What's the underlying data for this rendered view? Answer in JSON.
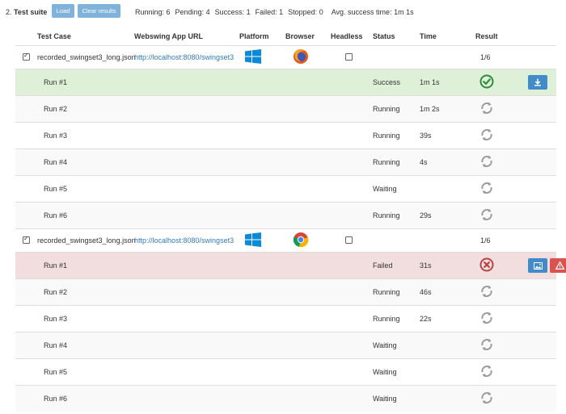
{
  "suite": {
    "index": "2.",
    "title": "Test suite"
  },
  "buttons": {
    "load": "Load",
    "clear": "Clear results"
  },
  "stats": {
    "running": "Running: 6",
    "pending": "Pending: 4",
    "success": "Success: 1",
    "failed": "Failed: 1",
    "stopped": "Stopped: 0",
    "avg": "Avg. success time: 1m 1s"
  },
  "columns": [
    "Test Case",
    "Webswing App URL",
    "Platform",
    "Browser",
    "Headless",
    "Status",
    "Time",
    "Result"
  ],
  "colors": {
    "success_bg": "#dff0d8",
    "failed_bg": "#f2dede",
    "blue_button": "#428bca",
    "red_button": "#d9534f",
    "link": "#337ab7"
  },
  "cases": [
    {
      "name": "recorded_swingset3_long.json",
      "url": "http://localhost:8080/swingset3",
      "platform_icon": "windows-icon",
      "browser_icon": "firefox-icon",
      "result": "1/6",
      "runs": [
        {
          "label": "Run #1",
          "status": "Success",
          "time": "1m 1s"
        },
        {
          "label": "Run #2",
          "status": "Running",
          "time": "1m 2s"
        },
        {
          "label": "Run #3",
          "status": "Running",
          "time": "39s"
        },
        {
          "label": "Run #4",
          "status": "Running",
          "time": "4s"
        },
        {
          "label": "Run #5",
          "status": "Waiting",
          "time": ""
        },
        {
          "label": "Run #6",
          "status": "Running",
          "time": "29s"
        }
      ]
    },
    {
      "name": "recorded_swingset3_long.json",
      "url": "http://localhost:8080/swingset3",
      "platform_icon": "windows-icon",
      "browser_icon": "chrome-icon",
      "result": "1/6",
      "runs": [
        {
          "label": "Run #1",
          "status": "Failed",
          "time": "31s"
        },
        {
          "label": "Run #2",
          "status": "Running",
          "time": "46s"
        },
        {
          "label": "Run #3",
          "status": "Running",
          "time": "22s"
        },
        {
          "label": "Run #4",
          "status": "Waiting",
          "time": ""
        },
        {
          "label": "Run #5",
          "status": "Waiting",
          "time": ""
        },
        {
          "label": "Run #6",
          "status": "Waiting",
          "time": ""
        }
      ]
    }
  ]
}
